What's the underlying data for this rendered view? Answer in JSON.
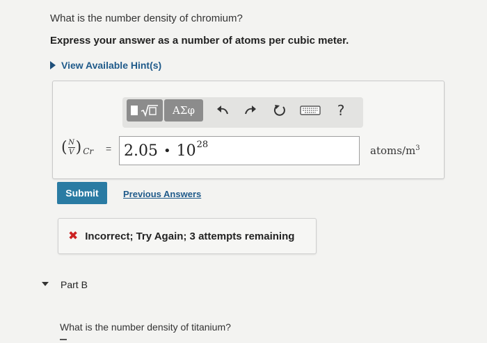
{
  "question": "What is the number density of chromium?",
  "instruction": "Express your answer as a number of atoms per cubic meter.",
  "hints_link": "View Available Hint(s)",
  "toolbar": {
    "greek_label": "ΑΣφ",
    "help_label": "?"
  },
  "equation": {
    "numerator": "N",
    "denominator": "V",
    "subscript": "Cr",
    "equals": "="
  },
  "answer": {
    "mantissa": "2.05",
    "times": "•",
    "base": "10",
    "exponent": "28"
  },
  "units": {
    "text": "atoms/m",
    "power": "3"
  },
  "submit_label": "Submit",
  "previous_answers_label": "Previous Answers",
  "feedback": {
    "icon": "✖",
    "text": "Incorrect; Try Again; 3 attempts remaining"
  },
  "part_b": {
    "label": "Part B",
    "question": "What is the number density of titanium?"
  }
}
